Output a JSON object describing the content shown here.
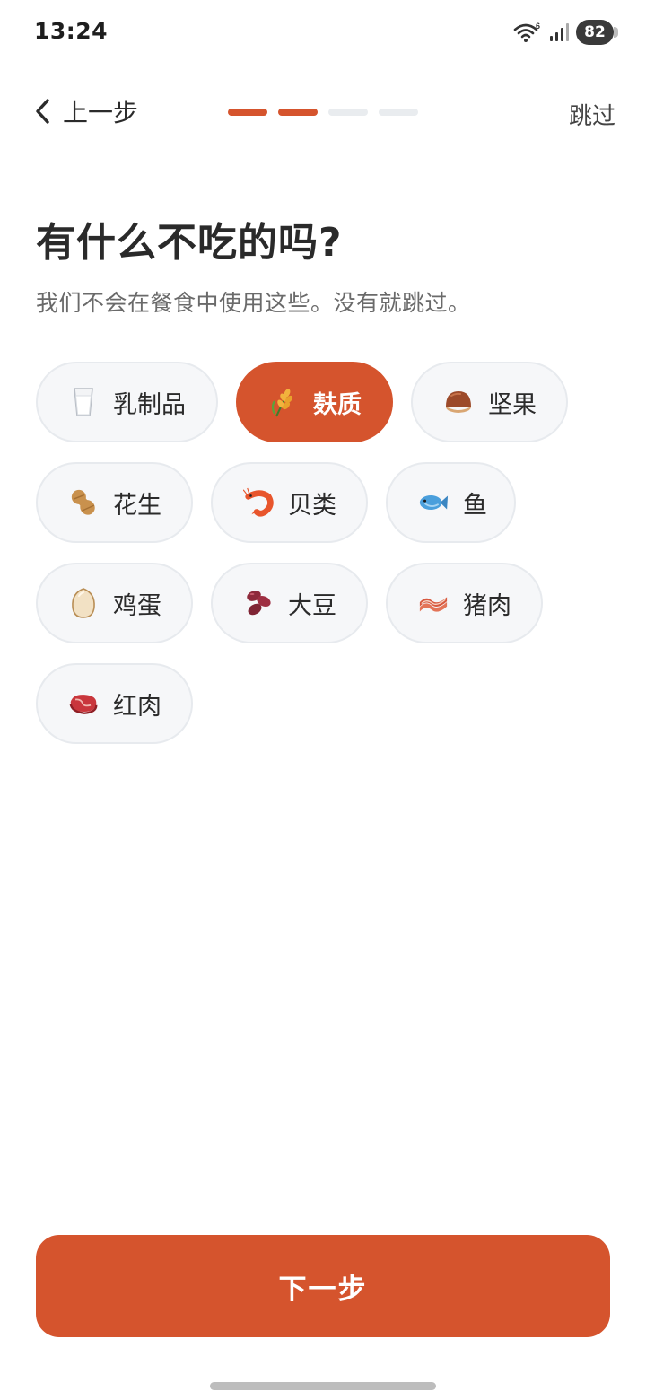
{
  "status_bar": {
    "time": "13:24",
    "wifi_badge": "6",
    "battery": "82",
    "icons": [
      "wifi-icon",
      "signal-icon",
      "battery-icon"
    ]
  },
  "nav": {
    "back_label": "上一步",
    "skip_label": "跳过",
    "progress_total": 4,
    "progress_completed": 2
  },
  "page": {
    "title": "有什么不吃的吗?",
    "subtitle": "我们不会在餐食中使用这些。没有就跳过。"
  },
  "options": [
    {
      "label": "乳制品",
      "icon": "milk-glass-icon",
      "selected": false
    },
    {
      "label": "麸质",
      "icon": "wheat-icon",
      "selected": true
    },
    {
      "label": "坚果",
      "icon": "chestnut-icon",
      "selected": false
    },
    {
      "label": "花生",
      "icon": "peanut-icon",
      "selected": false
    },
    {
      "label": "贝类",
      "icon": "shrimp-icon",
      "selected": false
    },
    {
      "label": "鱼",
      "icon": "fish-icon",
      "selected": false
    },
    {
      "label": "鸡蛋",
      "icon": "egg-icon",
      "selected": false
    },
    {
      "label": "大豆",
      "icon": "beans-icon",
      "selected": false
    },
    {
      "label": "猪肉",
      "icon": "bacon-icon",
      "selected": false
    },
    {
      "label": "红肉",
      "icon": "steak-icon",
      "selected": false
    }
  ],
  "actions": {
    "next_label": "下一步"
  },
  "colors": {
    "accent": "#d5542d",
    "chip_bg": "#f6f7f9",
    "chip_border": "#e7eaee",
    "progress_inactive": "#e9ecef"
  }
}
